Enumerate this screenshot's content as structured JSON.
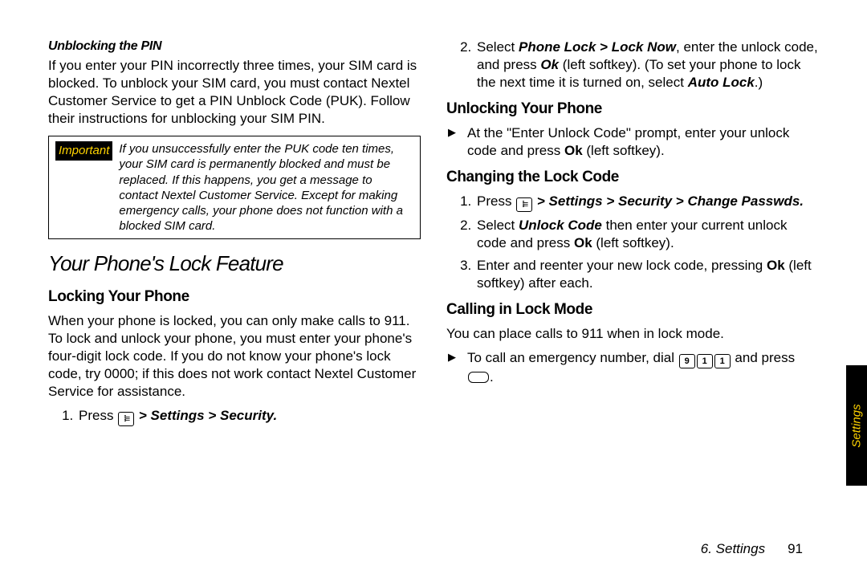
{
  "left": {
    "heading1": "Unblocking the PIN",
    "para1": "If you enter your PIN incorrectly three times, your SIM card is blocked. To unblock your SIM card, you must contact Nextel Customer Service to get a PIN Unblock Code (PUK). Follow their instructions for unblocking your SIM PIN.",
    "callout_label": "Important",
    "callout_body": "If you unsuccessfully enter the PUK code ten times, your SIM card is permanently blocked and must be replaced. If this happens, you get a message to contact Nextel Customer Service. Except for making emergency calls, your phone does not function with a blocked SIM card.",
    "section_title": "Your Phone's Lock Feature",
    "sub1": "Locking Your Phone",
    "para2": "When your phone is locked, you can only make calls to 911. To lock and unlock your phone, you must enter your phone's four-digit lock code. If you do not know your phone's lock code, try 0000; if this does not work contact Nextel Customer Service for assistance.",
    "step1_prefix": "Press ",
    "step1_rest": " > Settings > Security."
  },
  "right": {
    "step2_a": "Select ",
    "step2_b": "Phone Lock > Lock Now",
    "step2_c": ", enter the unlock code, and press ",
    "step2_d": "Ok",
    "step2_e": " (left softkey). (To set your phone to lock the next time it is turned on, select ",
    "step2_f": "Auto Lock",
    "step2_g": ".)",
    "sub2": "Unlocking Your Phone",
    "unlock_a": "At the \"Enter Unlock Code\" prompt, enter your unlock code and press ",
    "unlock_b": "Ok",
    "unlock_c": " (left softkey).",
    "sub3": "Changing the Lock Code",
    "chg1_a": "Press ",
    "chg1_b": " > Settings > Security > Change Passwds.",
    "chg2_a": "Select ",
    "chg2_b": "Unlock Code",
    "chg2_c": " then enter your current unlock code and press ",
    "chg2_d": "Ok",
    "chg2_e": " (left softkey).",
    "chg3_a": "Enter and reenter your new lock code, pressing ",
    "chg3_b": "Ok",
    "chg3_c": " (left softkey) after each.",
    "sub4": "Calling in Lock Mode",
    "call_para": "You can place calls to 911 when in lock mode.",
    "call_b_a": "To call an emergency number, dial ",
    "k9": "9",
    "k1a": "1",
    "k1b": "1",
    "call_b_b": " and press ",
    "call_b_c": "."
  },
  "tab": "Settings",
  "footer_chapter": "6. Settings",
  "footer_page": "91"
}
